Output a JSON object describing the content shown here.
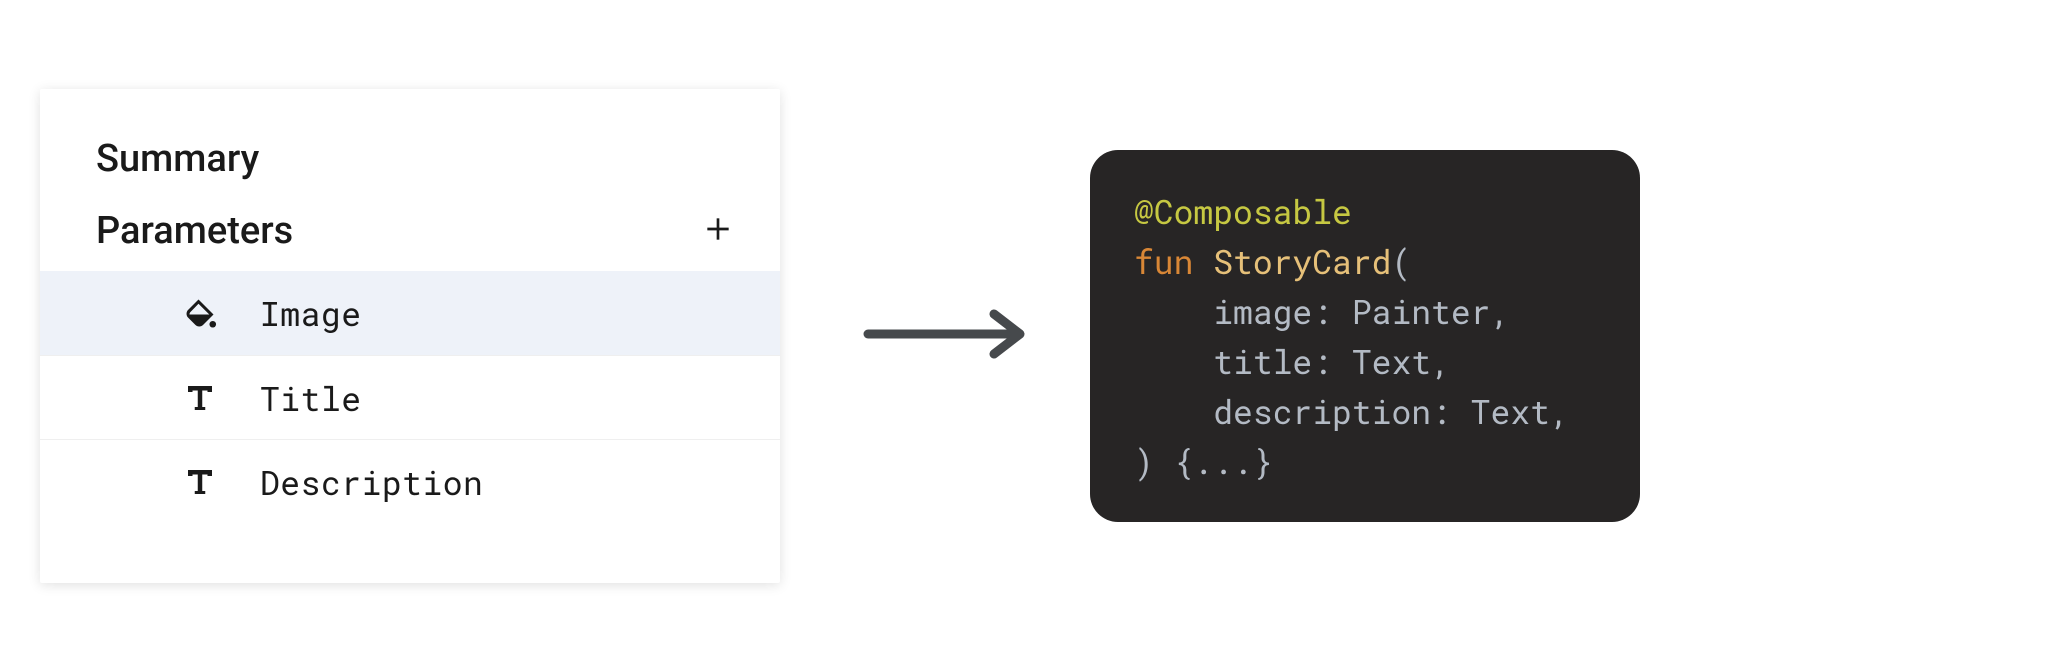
{
  "panel": {
    "title": "Summary",
    "sectionTitle": "Parameters",
    "items": [
      {
        "label": "Image",
        "icon": "fill",
        "selected": true
      },
      {
        "label": "Title",
        "icon": "text",
        "selected": false
      },
      {
        "label": "Description",
        "icon": "text",
        "selected": false
      }
    ]
  },
  "code": {
    "annotation": "@Composable",
    "keyword_fun": "fun",
    "funcName": "StoryCard",
    "open": "(",
    "params": [
      "    image: Painter,",
      "    title: Text,",
      "    description: Text,"
    ],
    "close": ") {...}"
  }
}
